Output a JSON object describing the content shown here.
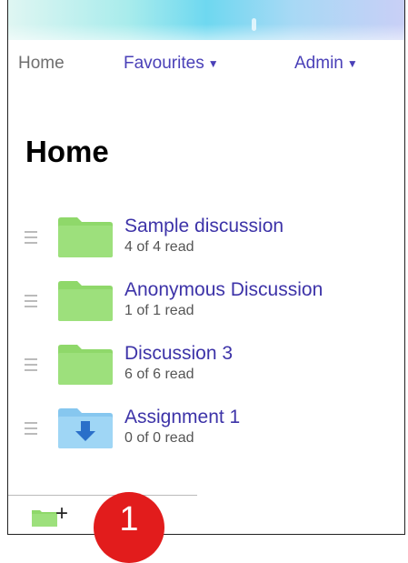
{
  "nav": {
    "home": "Home",
    "favourites": "Favourites",
    "admin": "Admin",
    "caret": "▼"
  },
  "page": {
    "title": "Home"
  },
  "items": [
    {
      "title": "Sample discussion",
      "status": "4 of 4 read",
      "icon": "folder-icon",
      "color": "#9de07c"
    },
    {
      "title": "Anonymous Discussion",
      "status": "1 of 1 read",
      "icon": "folder-icon",
      "color": "#9de07c"
    },
    {
      "title": "Discussion 3",
      "status": "6 of 6 read",
      "icon": "folder-icon",
      "color": "#9de07c"
    },
    {
      "title": "Assignment 1",
      "status": "0 of 0 read",
      "icon": "assignment-dropbox-icon",
      "color": "#9fd6f5"
    }
  ],
  "footer": {
    "add_icon": "add-folder-icon",
    "plus": "+"
  },
  "annotation": {
    "number": "1",
    "color": "#e21c1c"
  },
  "colors": {
    "link": "#3d33a8",
    "nav_inactive": "#6f6f6f"
  }
}
